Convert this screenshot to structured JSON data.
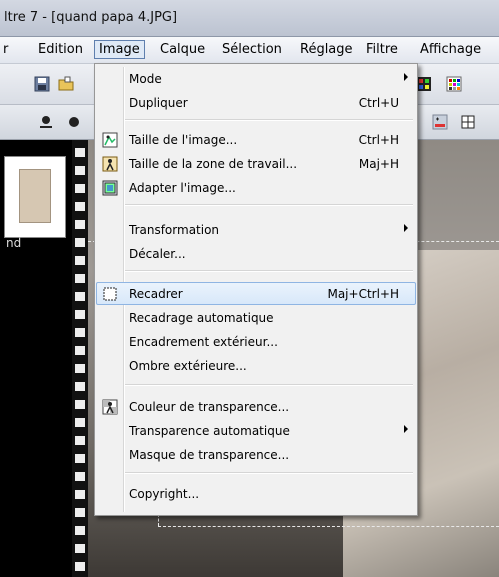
{
  "window": {
    "title": "ltre 7 - [quand papa 4.JPG]"
  },
  "menubar": {
    "items": [
      {
        "label": "r"
      },
      {
        "label": "Edition"
      },
      {
        "label": "Image"
      },
      {
        "label": "Calque"
      },
      {
        "label": "Sélection"
      },
      {
        "label": "Réglage"
      },
      {
        "label": "Filtre"
      },
      {
        "label": "Affichage"
      }
    ]
  },
  "thumbnail": {
    "label": "nd"
  },
  "image_menu": {
    "items": [
      {
        "label": "Mode",
        "shortcut": "",
        "submenu": true
      },
      {
        "label": "Dupliquer",
        "shortcut": "Ctrl+U"
      },
      {
        "label": "Taille de l'image...",
        "shortcut": "Ctrl+H",
        "icon": "resize-image-icon"
      },
      {
        "label": "Taille de la zone de travail...",
        "shortcut": "Maj+H",
        "icon": "canvas-size-icon"
      },
      {
        "label": "Adapter l'image...",
        "shortcut": "",
        "icon": "fit-image-icon"
      },
      {
        "label": "Transformation",
        "shortcut": "",
        "submenu": true
      },
      {
        "label": "Décaler...",
        "shortcut": ""
      },
      {
        "label": "Recadrer",
        "shortcut": "Maj+Ctrl+H",
        "icon": "crop-icon",
        "highlighted": true
      },
      {
        "label": "Recadrage automatique",
        "shortcut": ""
      },
      {
        "label": "Encadrement extérieur...",
        "shortcut": ""
      },
      {
        "label": "Ombre extérieure...",
        "shortcut": ""
      },
      {
        "label": "Couleur de transparence...",
        "shortcut": "",
        "icon": "transparency-color-icon"
      },
      {
        "label": "Transparence automatique",
        "shortcut": "",
        "submenu": true
      },
      {
        "label": "Masque de transparence...",
        "shortcut": ""
      },
      {
        "label": "Copyright...",
        "shortcut": ""
      }
    ]
  }
}
